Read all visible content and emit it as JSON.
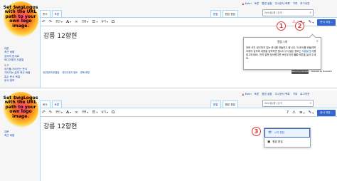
{
  "logo": {
    "text": "Set $wgLogos with the URL path to your own logo image."
  },
  "sidebar": {
    "items": [
      "대문",
      "최근 바뀜",
      "임의의 문서로",
      "미디어위키 도움말"
    ],
    "tools_heading": "도구",
    "tools": [
      "여기를 가리키는 문서",
      "가리키는 글의 최근 바뀜",
      "특수 문서 목록",
      "문서 정보"
    ]
  },
  "sidebar2": {
    "items": [
      "대문",
      "최근 바뀜"
    ]
  },
  "topbar": {
    "user": "Kuhn",
    "links": [
      "토론",
      "환경 설정",
      "주시문서 목록",
      "기여",
      "로그아웃"
    ]
  },
  "tabs": {
    "page": "문서",
    "talk": "토론"
  },
  "righttabs": {
    "read": "읽기",
    "edit": "편집",
    "edit_source": "원본 편집",
    "history": "역사 보기"
  },
  "search": {
    "placeholder": "Wiki을(를) 검색"
  },
  "toolbar": {
    "undo": "↶",
    "redo": "↷",
    "paragraph": "문단",
    "text_style": "A",
    "link": "🔗",
    "cite": "인용",
    "list": "☰",
    "insert": "넣기",
    "special": "Ω",
    "help": "?",
    "notice": "⚠",
    "menu": "≡",
    "edit_mode": "✎",
    "save": "문서 저장..."
  },
  "page": {
    "title": "강릉 12향현"
  },
  "footer": {
    "links": [
      "개인정보처리방침",
      "미디어위키 정보",
      "면책 조항"
    ],
    "logo1": "Powered by MediaWiki",
    "logo2": "Powered by MediaWiki"
  },
  "popup": {
    "title": "알림 1개",
    "close": "×",
    "body_1": "어떤 곳도 링크하지 않는 문서를 만들려고 합니다. 이 문서를 만들려면 아래의 상자에 내용을 입력하면 됩니다 (더 많은 정보는 ",
    "body_link": "도움말 문서",
    "body_2": "를 참고하세요). 만약 잘못 찾아왔다면 브라우저의 ",
    "body_bold": "뒤로",
    "body_3": " 버튼을 눌러 주세요."
  },
  "markers": {
    "m1": "1",
    "m2": "2",
    "m3": "3"
  },
  "menu": {
    "items": [
      {
        "label": "시각 편집",
        "icon": "👁"
      },
      {
        "label": "원본 편집",
        "icon": "▣"
      }
    ]
  }
}
